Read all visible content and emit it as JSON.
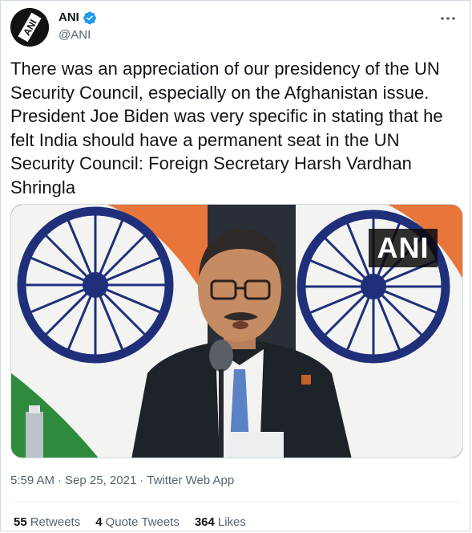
{
  "author": {
    "display_name": "ANI",
    "handle": "@ANI",
    "verified": true,
    "avatar_text": "ANI"
  },
  "icons": {
    "verified": "verified-badge-icon",
    "more": "more-options-icon"
  },
  "tweet": {
    "text": "There was an appreciation of our presidency of the UN Security Council, especially on the Afghanistan issue. President Joe Biden was very specific in stating that he felt India should have a permanent seat in the UN Security Council: Foreign Secretary Harsh Vardhan Shringla",
    "media_watermark": "ANI"
  },
  "meta": {
    "time": "5:59 AM",
    "separator": "·",
    "date": "Sep 25, 2021",
    "source": "Twitter Web App"
  },
  "stats": {
    "retweets_count": "55",
    "retweets_label": "Retweets",
    "quotes_count": "4",
    "quotes_label": "Quote Tweets",
    "likes_count": "364",
    "likes_label": "Likes"
  },
  "colors": {
    "verified_blue": "#1d9bf0",
    "text_primary": "#0f1419",
    "text_secondary": "#536471",
    "border": "#cfd9de",
    "flag_saffron": "#e8763a",
    "flag_green": "#2e8b3e",
    "chakra_navy": "#1f2f7a"
  }
}
